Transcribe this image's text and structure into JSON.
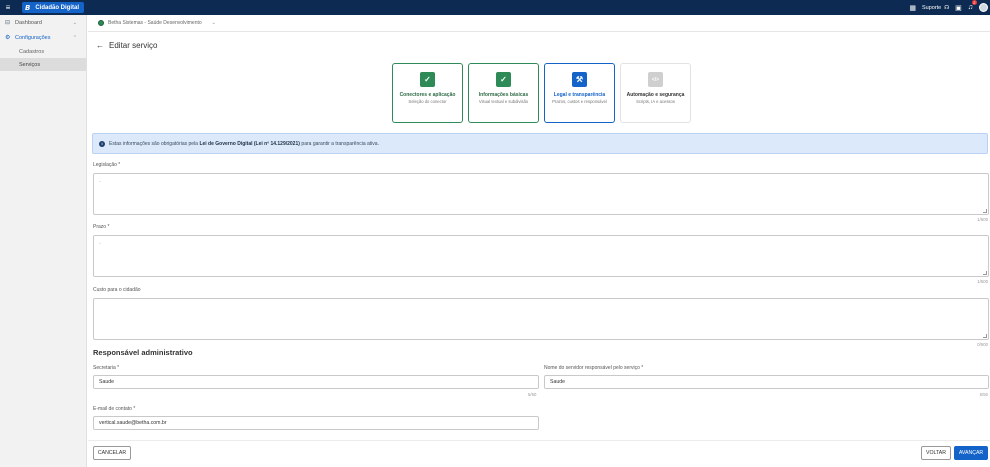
{
  "app": {
    "brand_logo": "B",
    "title": "Cidadão Digital"
  },
  "topbar": {
    "support_label": "Suporte",
    "notification_count": "2"
  },
  "sidebar": {
    "items": [
      {
        "label": "Dashboard"
      },
      {
        "label": "Configurações"
      }
    ],
    "subitems": [
      {
        "label": "Cadastros"
      },
      {
        "label": "Serviços"
      }
    ]
  },
  "context": {
    "entity": "Betha Sistemas - Saúde Desenvolvimento"
  },
  "page": {
    "back_arrow": "←",
    "title": "Editar serviço"
  },
  "steps": [
    {
      "title": "Conectores e aplicação",
      "subtitle": "Seleção do conector",
      "state": "done",
      "icon": "check-icon"
    },
    {
      "title": "Informações básicas",
      "subtitle": "Visual textual e subdivisão",
      "state": "done",
      "icon": "check-icon"
    },
    {
      "title": "Legal e transparência",
      "subtitle": "Prazos, custos e responsável",
      "state": "active",
      "icon": "gavel-icon"
    },
    {
      "title": "Automação e segurança",
      "subtitle": "Scripts, IA e acessos",
      "state": "pending",
      "icon": "code-icon"
    }
  ],
  "info": {
    "prefix": "Estas informações são obrigatórias pela",
    "law": "Lei de Governo Digital (Lei nº 14.129/2021)",
    "suffix": "para garantir a transparência ativa."
  },
  "form": {
    "legislacao": {
      "label": "Legislação *",
      "placeholder": "-",
      "counter": "1/500"
    },
    "prazo": {
      "label": "Prazo *",
      "placeholder": "-",
      "counter": "1/500"
    },
    "custo": {
      "label": "Custo para o cidadão",
      "placeholder": "",
      "counter": "0/500"
    },
    "responsavel_title": "Responsável administrativo",
    "secretaria": {
      "label": "Secretaria *",
      "value": "Saude",
      "counter": "5/50"
    },
    "servidor": {
      "label": "Nome do servidor responsável pelo serviço *",
      "value": "Saude",
      "counter": "5/50"
    },
    "email": {
      "label": "E-mail de contato *",
      "value": "vertical.saude@betha.com.br"
    }
  },
  "buttons": {
    "cancel": "CANCELAR",
    "back": "VOLTAR",
    "next": "AVANÇAR"
  },
  "colors": {
    "topbar": "#0d2b52",
    "primary": "#1463c9",
    "success": "#2e8b57",
    "info_bg": "#dbe9fb"
  }
}
